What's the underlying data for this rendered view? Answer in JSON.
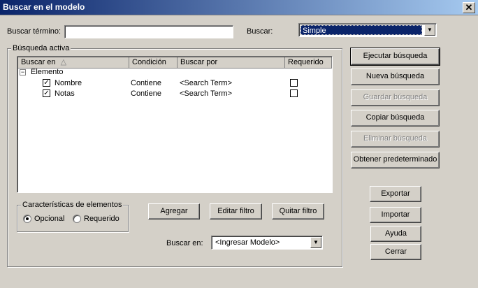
{
  "window": {
    "title": "Buscar en el modelo",
    "close_glyph": "✕"
  },
  "search": {
    "term_label": "Buscar término:",
    "term_value": "",
    "mode_label": "Buscar:",
    "mode_value": "Simple"
  },
  "active_search": {
    "legend": "Búsqueda activa",
    "columns": [
      "Buscar en",
      "Condición",
      "Buscar por",
      "Requerido"
    ],
    "sort_indicator": "△",
    "tree_toggle": "−",
    "root": "Elemento",
    "rows": [
      {
        "field": "Nombre",
        "checked": "✓",
        "condition": "Contiene",
        "value": "<Search Term>",
        "required": false
      },
      {
        "field": "Notas",
        "checked": "✓",
        "condition": "Contiene",
        "value": "<Search Term>",
        "required": false
      }
    ]
  },
  "characteristics": {
    "legend": "Características de elementos",
    "optional": "Opcional",
    "required": "Requerido",
    "selected": "optional"
  },
  "filter_buttons": {
    "add": "Agregar",
    "edit": "Editar filtro",
    "remove": "Quitar filtro"
  },
  "search_in": {
    "label": "Buscar en:",
    "value": "<Ingresar Modelo>"
  },
  "side_buttons": {
    "execute": "Ejecutar búsqueda",
    "new": "Nueva búsqueda",
    "save": "Guardar búsqueda",
    "copy": "Copiar  búsqueda",
    "delete": "Eliminar búsqueda",
    "default": "Obtener predeterminado",
    "export": "Exportar",
    "import": "Importar",
    "help": "Ayuda",
    "close": "Cerrar"
  },
  "icons": {
    "dropdown_arrow": "▼"
  }
}
